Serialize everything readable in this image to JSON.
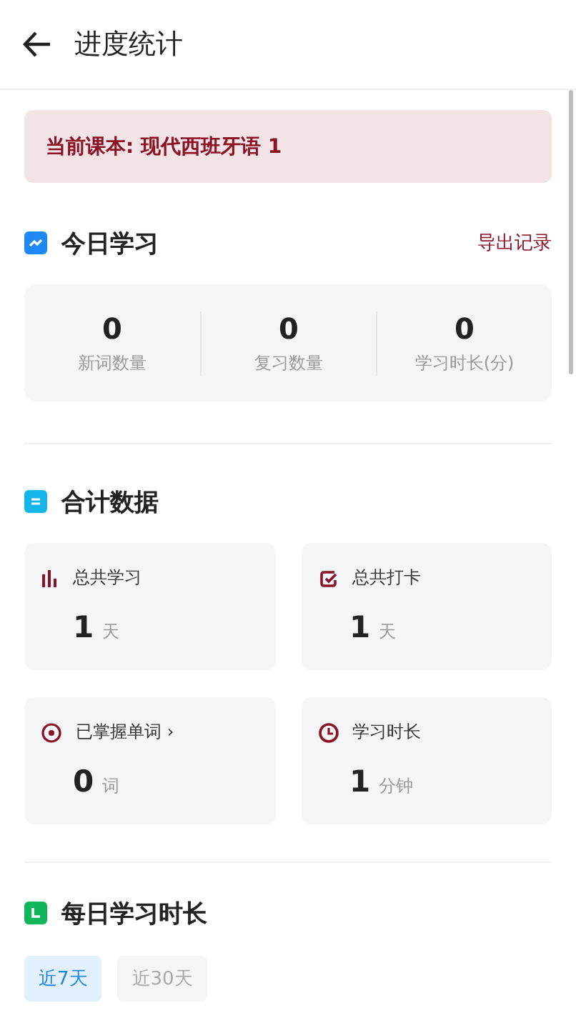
{
  "header": {
    "title": "进度统计"
  },
  "banner": "当前课本: 现代西班牙语 1",
  "today": {
    "title": "今日学习",
    "action": "导出记录",
    "stats": [
      {
        "value": "0",
        "label": "新词数量"
      },
      {
        "value": "0",
        "label": "复习数量"
      },
      {
        "value": "0",
        "label": "学习时长(分)"
      }
    ]
  },
  "totals": {
    "title": "合计数据",
    "cards": [
      {
        "kind": "bars",
        "label": "总共学习",
        "value": "1",
        "unit": "天"
      },
      {
        "kind": "check",
        "label": "总共打卡",
        "value": "1",
        "unit": "天"
      },
      {
        "kind": "target",
        "label": "已掌握单词 ›",
        "value": "0",
        "unit": "词"
      },
      {
        "kind": "clock",
        "label": "学习时长",
        "value": "1",
        "unit": "分钟"
      }
    ]
  },
  "daily": {
    "title": "每日学习时长",
    "ranges": [
      {
        "label": "近7天",
        "selected": true
      },
      {
        "label": "近30天",
        "selected": false
      }
    ]
  }
}
